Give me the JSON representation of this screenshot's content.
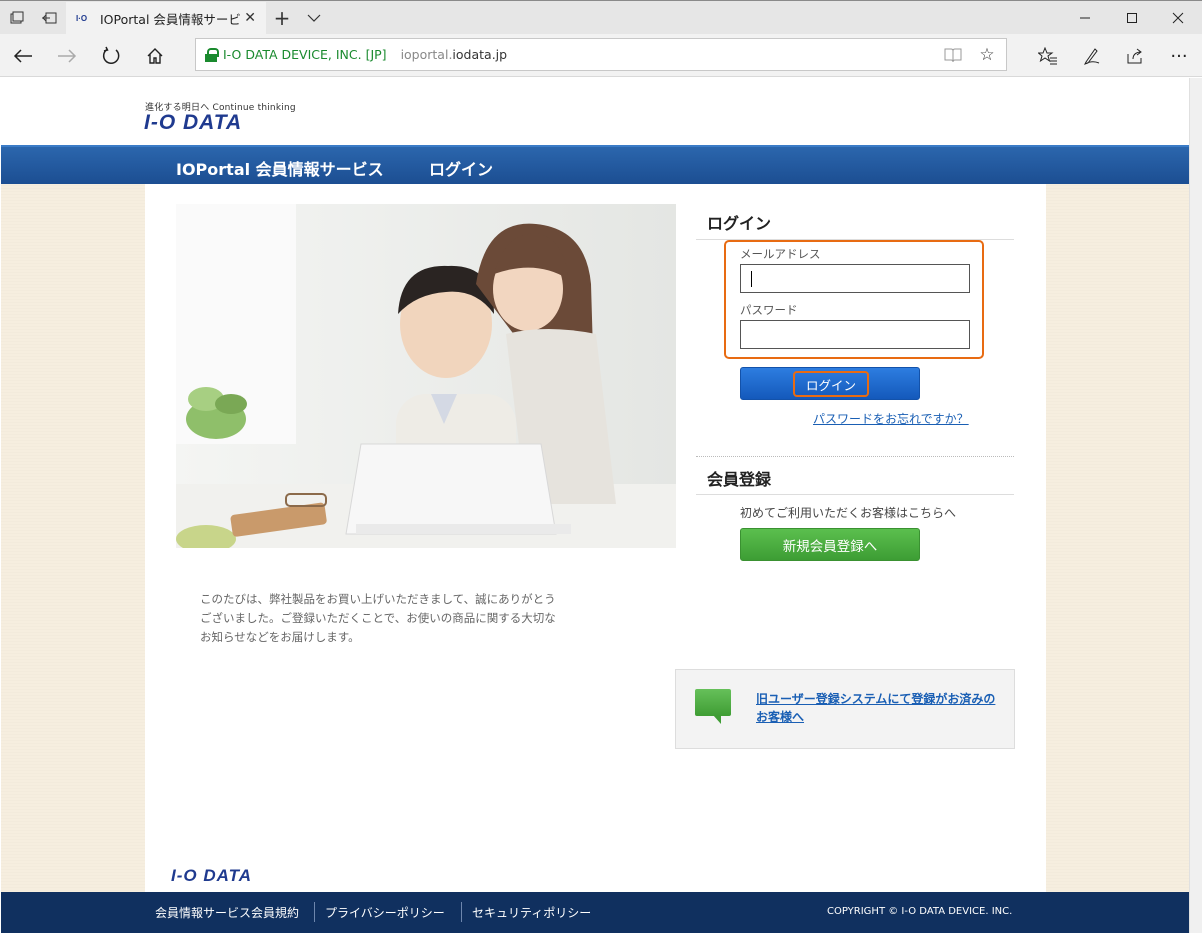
{
  "browser": {
    "tab_title": "IOPortal 会員情報サービス",
    "tab_favicon": "I·O",
    "url_org": "I-O DATA DEVICE, INC. [JP]",
    "url_host_prefix": "ioportal.",
    "url_host_domain": "iodata.jp",
    "icons": [
      "tab-list-icon",
      "set-aside-icon",
      "new-tab-icon",
      "tab-preview-icon",
      "back-icon",
      "forward-icon",
      "refresh-icon",
      "home-icon",
      "reading-view-icon",
      "favorite-star-icon",
      "favorites-hub-icon",
      "pen-icon",
      "share-icon",
      "more-icon",
      "minimize-icon",
      "maximize-icon",
      "close-window-icon"
    ]
  },
  "header": {
    "tagline": "進化する明日へ Continue thinking",
    "logo": "I-O DATA",
    "service_title": "IOPortal 会員情報サービス",
    "page_title": "ログイン"
  },
  "intro": {
    "text": "このたびは、弊社製品をお買い上げいただきまして、誠にありがとうございました。ご登録いただくことで、お使いの商品に関する大切なお知らせなどをお届けします。"
  },
  "login": {
    "title": "ログイン",
    "email_label": "メールアドレス",
    "email_value": "",
    "password_label": "パスワード",
    "password_value": "",
    "button": "ログイン",
    "forgot": "パスワードをお忘れですか？"
  },
  "register": {
    "title": "会員登録",
    "note": "初めてご利用いただくお客様はこちらへ",
    "button": "新規会員登録へ"
  },
  "old_system": {
    "link": "旧ユーザー登録システムにて登録がお済みのお客様へ"
  },
  "footer": {
    "logo": "I-O DATA",
    "links": [
      "会員情報サービス会員規約",
      "プライバシーポリシー",
      "セキュリティポリシー"
    ],
    "copyright": "COPYRIGHT © I-O DATA DEVICE. INC."
  },
  "colors": {
    "brand_blue": "#1c4e92",
    "accent_orange": "#e86b12",
    "button_blue": "#1459bb",
    "button_green": "#3d9d34",
    "footer_navy": "#10305f"
  }
}
